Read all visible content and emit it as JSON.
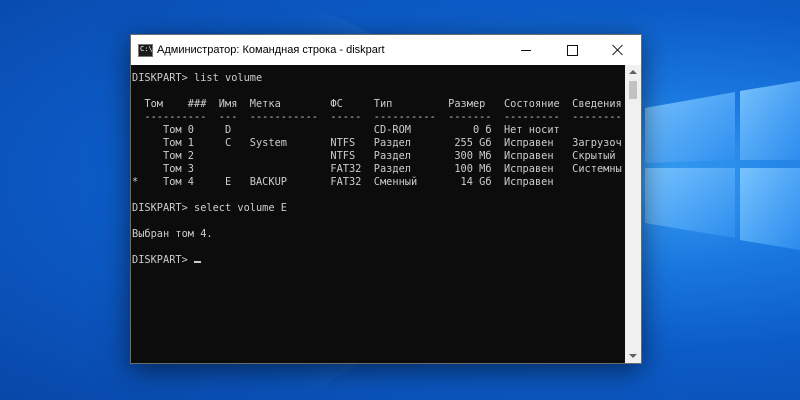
{
  "window": {
    "title": "Администратор: Командная строка - diskpart",
    "icon": "cmd-icon",
    "icon_glyph": "C:\\"
  },
  "controls": {
    "minimize_icon": "minimize-icon",
    "maximize_icon": "maximize-icon",
    "close_icon": "close-icon"
  },
  "console": {
    "lines": [
      "DISKPART> list volume",
      "",
      "  Том    ###  Имя  Метка        ФС     Тип         Размер   Состояние  Сведения",
      "  ----------  ---  -----------  -----  ----------  -------  ---------  --------",
      "     Том 0     D                       CD-ROM          0 б  Нет носит",
      "     Том 1     C   System       NTFS   Раздел       255 Gб  Исправен   Загрузоч",
      "     Том 2                      NTFS   Раздел       300 Мб  Исправен   Скрытый",
      "     Том 3                      FAT32  Раздел       100 Мб  Исправен   Системны",
      "*    Том 4     E   BACKUP       FAT32  Сменный       14 Gб  Исправен",
      "",
      "DISKPART> select volume E",
      "",
      "Выбран том 4.",
      "",
      "DISKPART> "
    ]
  },
  "colors": {
    "console_background": "#0c0c0c",
    "console_text": "#cccccc",
    "desktop_blue": "#0c5cc8"
  }
}
